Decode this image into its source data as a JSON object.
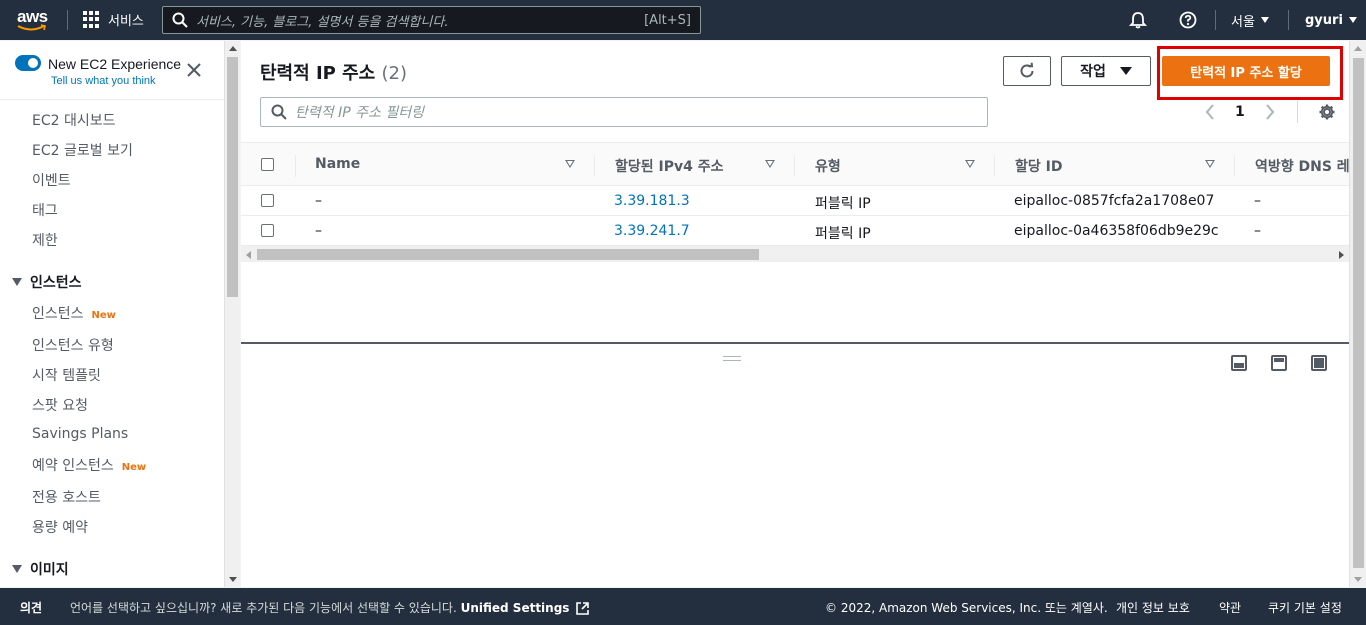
{
  "topnav": {
    "logo_text": "aws",
    "services_label": "서비스",
    "search_placeholder": "서비스, 기능, 블로그, 설명서 등을 검색합니다.",
    "search_shortcut": "[Alt+S]",
    "region_label": "서울",
    "user_label": "gyuri",
    "icons": [
      "grid-icon",
      "search-icon",
      "bell-icon",
      "help-icon"
    ]
  },
  "sidebar": {
    "experience_title": "New EC2 Experience",
    "experience_link": "Tell us what you think",
    "experience_toggle_on": true,
    "items_top": [
      "EC2 대시보드",
      "EC2 글로벌 보기",
      "이벤트",
      "태그",
      "제한"
    ],
    "section_instances": "인스턴스",
    "instance_items": [
      {
        "label": "인스턴스",
        "badge": "New"
      },
      {
        "label": "인스턴스 유형",
        "badge": ""
      },
      {
        "label": "시작 템플릿",
        "badge": ""
      },
      {
        "label": "스팟 요청",
        "badge": ""
      },
      {
        "label": "Savings Plans",
        "badge": ""
      },
      {
        "label": "예약 인스턴스",
        "badge": "New"
      },
      {
        "label": "전용 호스트",
        "badge": ""
      },
      {
        "label": "용량 예약",
        "badge": ""
      }
    ],
    "section_images": "이미지"
  },
  "main": {
    "title": "탄력적 IP 주소",
    "count": "(2)",
    "action_label": "작업",
    "allocate_label": "탄력적 IP 주소 할당",
    "filter_placeholder": "탄력적 IP 주소 필터링",
    "page_number": "1",
    "columns": [
      "Name",
      "할당된 IPv4 주소",
      "유형",
      "할당 ID",
      "역방향 DNS 레"
    ],
    "rows": [
      {
        "name": "–",
        "ipv4": "3.39.181.3",
        "type": "퍼블릭 IP",
        "allocation_id": "eipalloc-0857fcfa2a1708e07",
        "reverse_dns": "–"
      },
      {
        "name": "–",
        "ipv4": "3.39.241.7",
        "type": "퍼블릭 IP",
        "allocation_id": "eipalloc-0a46358f06db9e29c",
        "reverse_dns": "–"
      }
    ]
  },
  "footer": {
    "feedback": "의견",
    "language_text": "언어를 선택하고 싶으십니까? 새로 추가된 다음 기능에서 선택할 수 있습니다.",
    "unified_settings": "Unified Settings",
    "copyright": "© 2022, Amazon Web Services, Inc. 또는 계열사.",
    "privacy": "개인 정보 보호",
    "terms": "약관",
    "cookie": "쿠키 기본 설정"
  },
  "colors": {
    "nav_bg": "#232f3e",
    "accent_orange": "#ec7211",
    "link_blue": "#0073bb",
    "highlight_red": "#df0000"
  }
}
